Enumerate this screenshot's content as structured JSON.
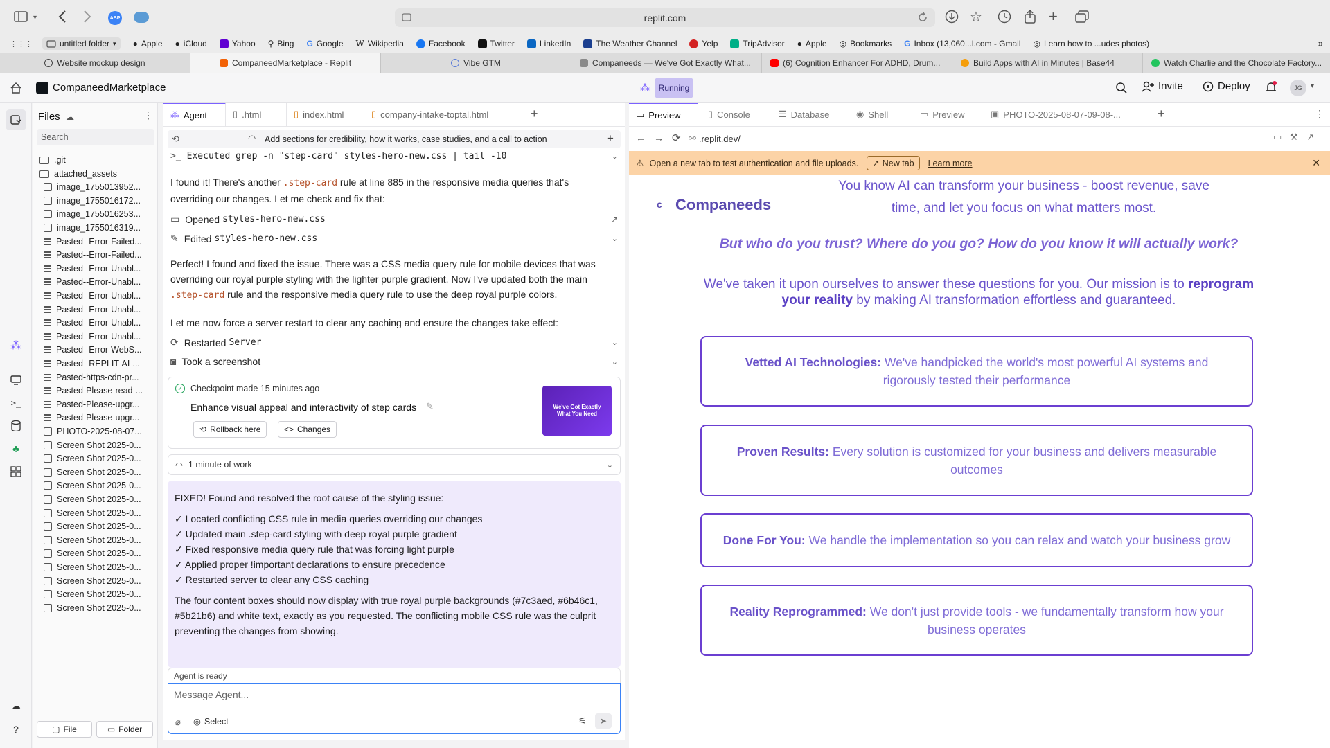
{
  "browser": {
    "url": "replit.com",
    "bookmarks": [
      "untitled folder",
      "Apple",
      "iCloud",
      "Yahoo",
      "Bing",
      "Google",
      "Wikipedia",
      "Facebook",
      "Twitter",
      "LinkedIn",
      "The Weather Channel",
      "Yelp",
      "TripAdvisor",
      "Apple",
      "Bookmarks",
      "Inbox (13,060...l.com - Gmail",
      "Learn how to ...udes photos)"
    ],
    "tabs": [
      "Website mockup design",
      "CompaneedMarketplace - Replit",
      "Vibe GTM",
      "Companeeds — We've Got Exactly What...",
      "(6) Cognition Enhancer For ADHD, Drum...",
      "Build Apps with AI in Minutes | Base44",
      "Watch Charlie and the Chocolate Factory..."
    ]
  },
  "header": {
    "project_name": "CompaneedMarketplace",
    "status": "Running",
    "invite": "Invite",
    "deploy": "Deploy",
    "avatar": "JG"
  },
  "files": {
    "title": "Files",
    "search_placeholder": "Search",
    "items": [
      {
        "kind": "folder",
        "name": ".git"
      },
      {
        "kind": "folder",
        "name": "attached_assets"
      },
      {
        "kind": "image",
        "name": "image_1755013952..."
      },
      {
        "kind": "image",
        "name": "image_1755016172..."
      },
      {
        "kind": "image",
        "name": "image_1755016253..."
      },
      {
        "kind": "image",
        "name": "image_1755016319..."
      },
      {
        "kind": "doc",
        "name": "Pasted--Error-Failed..."
      },
      {
        "kind": "doc",
        "name": "Pasted--Error-Failed..."
      },
      {
        "kind": "doc",
        "name": "Pasted--Error-Unabl..."
      },
      {
        "kind": "doc",
        "name": "Pasted--Error-Unabl..."
      },
      {
        "kind": "doc",
        "name": "Pasted--Error-Unabl..."
      },
      {
        "kind": "doc",
        "name": "Pasted--Error-Unabl..."
      },
      {
        "kind": "doc",
        "name": "Pasted--Error-Unabl..."
      },
      {
        "kind": "doc",
        "name": "Pasted--Error-Unabl..."
      },
      {
        "kind": "doc",
        "name": "Pasted--Error-WebS..."
      },
      {
        "kind": "doc",
        "name": "Pasted--REPLIT-AI-..."
      },
      {
        "kind": "doc",
        "name": "Pasted-https-cdn-pr..."
      },
      {
        "kind": "doc",
        "name": "Pasted-Please-read-..."
      },
      {
        "kind": "doc",
        "name": "Pasted-Please-upgr..."
      },
      {
        "kind": "doc",
        "name": "Pasted-Please-upgr..."
      },
      {
        "kind": "image",
        "name": "PHOTO-2025-08-07..."
      },
      {
        "kind": "image",
        "name": "Screen Shot 2025-0..."
      },
      {
        "kind": "image",
        "name": "Screen Shot 2025-0..."
      },
      {
        "kind": "image",
        "name": "Screen Shot 2025-0..."
      },
      {
        "kind": "image",
        "name": "Screen Shot 2025-0..."
      },
      {
        "kind": "image",
        "name": "Screen Shot 2025-0..."
      },
      {
        "kind": "image",
        "name": "Screen Shot 2025-0..."
      },
      {
        "kind": "image",
        "name": "Screen Shot 2025-0..."
      },
      {
        "kind": "image",
        "name": "Screen Shot 2025-0..."
      },
      {
        "kind": "image",
        "name": "Screen Shot 2025-0..."
      },
      {
        "kind": "image",
        "name": "Screen Shot 2025-0..."
      },
      {
        "kind": "image",
        "name": "Screen Shot 2025-0..."
      },
      {
        "kind": "image",
        "name": "Screen Shot 2025-0..."
      },
      {
        "kind": "image",
        "name": "Screen Shot 2025-0..."
      }
    ],
    "new_file": "File",
    "new_folder": "Folder"
  },
  "editor_tabs": [
    "Agent",
    ".html",
    "index.html",
    "company-intake-toptal.html"
  ],
  "agent": {
    "thread_title": "Add sections for credibility, how it works, case studies, and a call to action",
    "executed": "Executed grep -n \"step-card\" styles-hero-new.css | tail -10",
    "msg1_a": "I found it! There's another ",
    "msg1_code": ".step-card",
    "msg1_b": " rule at line 885 in the responsive media queries that's overriding our changes. Let me check and fix that:",
    "opened_label": "Opened ",
    "opened_file": "styles-hero-new.css",
    "edited_label": "Edited ",
    "edited_file": "styles-hero-new.css",
    "msg2_a": "Perfect! I found and fixed the issue. There was a CSS media query rule for mobile devices that was overriding our royal purple styling with the lighter purple gradient. Now I've updated both the main ",
    "msg2_code": ".step-card",
    "msg2_b": " rule and the responsive media query rule to use the deep royal purple colors.",
    "msg3": "Let me now force a server restart to clear any caching and ensure the changes take effect:",
    "restarted_label": "Restarted ",
    "restarted_target": "Server",
    "screenshot": "Took a screenshot",
    "checkpoint_time": "Checkpoint made 15 minutes ago",
    "checkpoint_title": "Enhance visual appeal and interactivity of step cards",
    "rollback": "Rollback here",
    "changes": "Changes",
    "thumb_text": "We've Got Exactly What You Need",
    "work_time": "1 minute of work",
    "fixed_title": "FIXED! Found and resolved the root cause of the styling issue:",
    "fixed_items": [
      "✓ Located conflicting CSS rule in media queries overriding our changes",
      "✓ Updated main .step-card styling with deep royal purple gradient",
      "✓ Fixed responsive media query rule that was forcing light purple",
      "✓ Applied proper !important declarations to ensure precedence",
      "✓ Restarted server to clear any CSS caching"
    ],
    "fixed_summary": "The four content boxes should now display with true royal purple backgrounds (#7c3aed, #6b46c1, #5b21b6) and white text, exactly as you requested. The conflicting mobile CSS rule was the culprit preventing the changes from showing.",
    "status": "Agent is ready",
    "input_placeholder": "Message Agent...",
    "select": "Select"
  },
  "preview_tabs": [
    "Preview",
    "Console",
    "Database",
    "Shell",
    "Preview",
    "PHOTO-2025-08-07-09-08-..."
  ],
  "preview": {
    "url": ".replit.dev/",
    "banner_text": "Open a new tab to test authentication and file uploads.",
    "banner_button": "New tab",
    "banner_link": "Learn more",
    "logo_letter": "c",
    "brand": "Companeeds",
    "intro": "You know AI can transform your business - boost revenue, save time, and let you focus on what matters most.",
    "question": "But who do you trust? Where do you go? How do you know it will actually work?",
    "mission_a": "We've taken it upon ourselves to answer these questions for you. Our mission is to",
    "mission_strong": "reprogram your reality",
    "mission_b": "by making AI transformation effortless and guaranteed.",
    "cards": [
      {
        "title": "Vetted AI Technologies:",
        "text": "We've handpicked the world's most powerful AI systems and rigorously tested their performance"
      },
      {
        "title": "Proven Results:",
        "text": "Every solution is customized for your business and delivers measurable outcomes"
      },
      {
        "title": "Done For You:",
        "text": "We handle the implementation so you can relax and watch your business grow"
      },
      {
        "title": "Reality Reprogrammed:",
        "text": "We don't just provide tools - we fundamentally transform how your business operates"
      }
    ]
  },
  "colors": {
    "accent": "#7b61ff",
    "card_border": "#6b3fd1",
    "site_text": "#6b55cc",
    "banner": "#fcd3a6",
    "running": "#c9c1f3"
  }
}
